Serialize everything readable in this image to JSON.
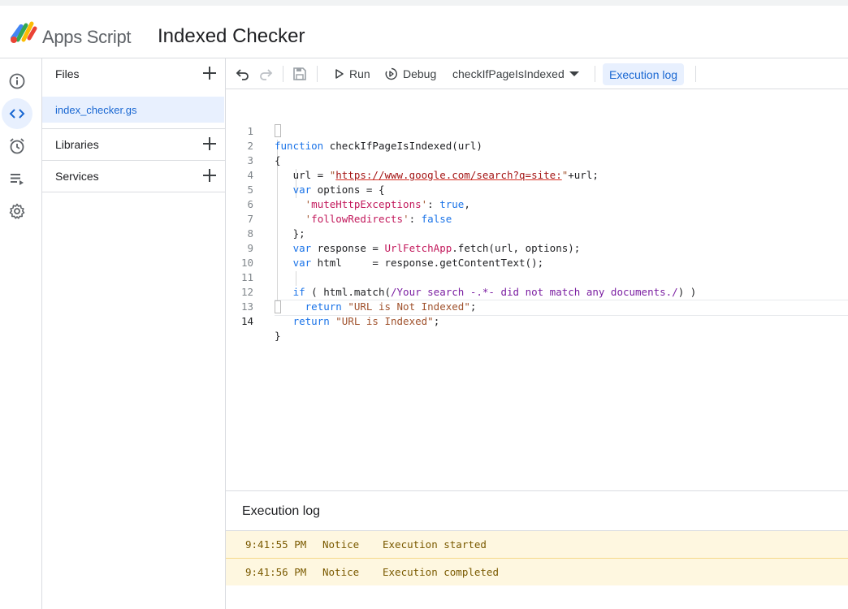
{
  "header": {
    "app_name": "Apps Script",
    "project_title": "Indexed Checker"
  },
  "rail": {
    "items": [
      "overview-icon",
      "editor-icon",
      "triggers-icon",
      "executions-icon",
      "settings-icon"
    ],
    "active": "editor-icon"
  },
  "files_panel": {
    "files_label": "Files",
    "files": [
      {
        "name": "index_checker.gs",
        "selected": true
      }
    ],
    "libraries_label": "Libraries",
    "services_label": "Services"
  },
  "toolbar": {
    "run_label": "Run",
    "debug_label": "Debug",
    "function_name": "checkIfPageIsIndexed",
    "execution_log_label": "Execution log"
  },
  "editor": {
    "line_numbers": [
      "1",
      "2",
      "3",
      "4",
      "5",
      "6",
      "7",
      "8",
      "9",
      "10",
      "11",
      "12",
      "13",
      "14"
    ],
    "lines": [
      "function checkIfPageIsIndexed(url)",
      "{",
      "  url = \"https://www.google.com/search?q=site:\"+url;",
      "  var options = {",
      "    'muteHttpExceptions': true,",
      "    'followRedirects': false",
      "  };",
      "  var response = UrlFetchApp.fetch(url, options);",
      "  var html     = response.getContentText();",
      "",
      "  if ( html.match(/Your search -.*- did not match any documents./) )",
      "    return \"URL is Not Indexed\";",
      "  return \"URL is Indexed\";",
      "}"
    ]
  },
  "execution_log": {
    "title": "Execution log",
    "entries": [
      {
        "time": "9:41:55 PM",
        "level": "Notice",
        "message": "Execution started"
      },
      {
        "time": "9:41:56 PM",
        "level": "Notice",
        "message": "Execution completed"
      }
    ]
  },
  "colors": {
    "accent": "#1967d2",
    "selected_bg": "#e8f0fe",
    "log_bg": "#fef7e0",
    "log_text": "#7a5a00"
  }
}
